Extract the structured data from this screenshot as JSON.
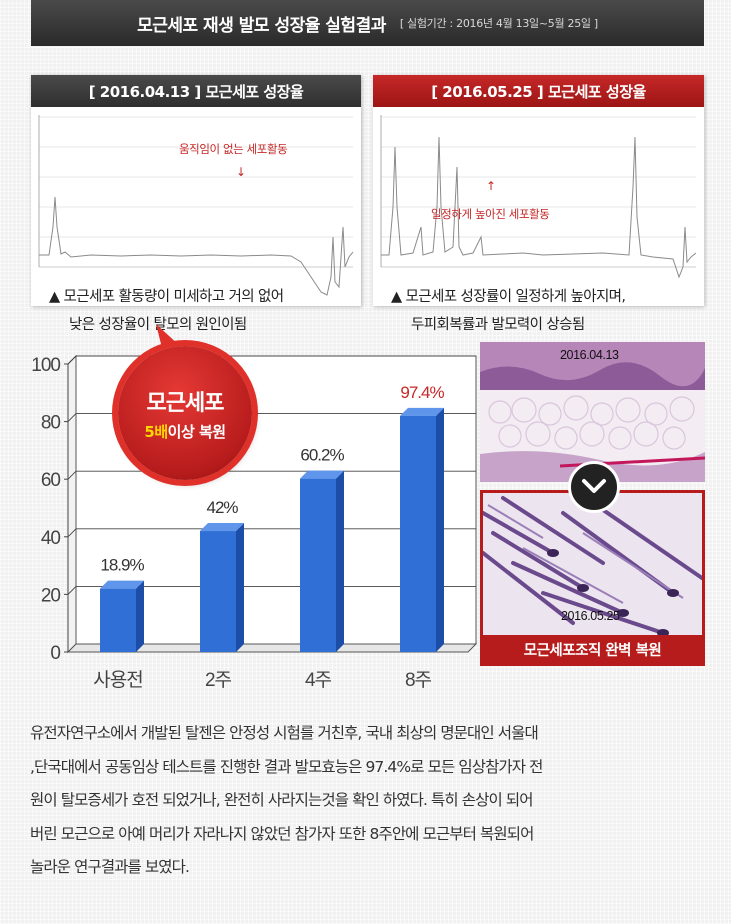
{
  "header": {
    "title": "모근세포 재생 발모 성장율 실험결과",
    "period": "[ 실험기간 : 2016년 4월 13일~5월 25일 ]"
  },
  "before_panel": {
    "heading": "[ 2016.04.13 ]  모근세포 성장율",
    "annotation": "움직임이 없는 세포활동",
    "caption_line1": "▲ 모근세포 활동량이 미세하고 거의 없어",
    "caption_line2": "낮은 성장율이 탈모의 원인이됨"
  },
  "after_panel": {
    "heading": "[ 2016.05.25 ] 모근세포 성장율",
    "annotation": "일정하게 높아진 세포활동",
    "caption_line1": "▲ 모근세포 성장률이 일정하게 높아지며,",
    "caption_line2": "두피회복률과 발모력이 상승됨"
  },
  "badge": {
    "title": "모근세포",
    "sub_highlight": "5배",
    "sub_rest": "이상 복원"
  },
  "chart_data": {
    "type": "bar",
    "categories": [
      "사용전",
      "2주",
      "4주",
      "8주"
    ],
    "values": [
      22,
      42,
      60.2,
      82
    ],
    "data_labels": [
      "18.9%",
      "42%",
      "60.2%",
      "97.4%"
    ],
    "highlight_label_index": 3,
    "yticks": [
      "0",
      "20",
      "40",
      "60",
      "80",
      "100"
    ],
    "ylim": [
      0,
      100
    ],
    "colors": {
      "bar": "#2f6fd6",
      "bar_dark": "#1c4ea8",
      "highlight_label": "#c62828"
    }
  },
  "tissue": {
    "before_date": "2016.04.13",
    "after_date": "2016.05.25",
    "caption": "모근세포조직 완벽 복원"
  },
  "body_lines": [
    "유전자연구소에서 개발된 탈젠은 안정성 시험를 거친후, 국내 최상의 명문대인 서울대",
    ",단국대에서 공동임상 테스트를 진행한 결과 발모효능은 97.4%로 모든 임상참가자 전",
    "원이 탈모증세가 호전 되었거나, 완전히 사라지는것을 확인 하였다. 특히 손상이 되어",
    "버린 모근으로 아예 머리가 자라나지 않았던 참가자 또한 8주안에 모근부터 복원되어",
    "놀라운 연구결과를 보였다."
  ]
}
